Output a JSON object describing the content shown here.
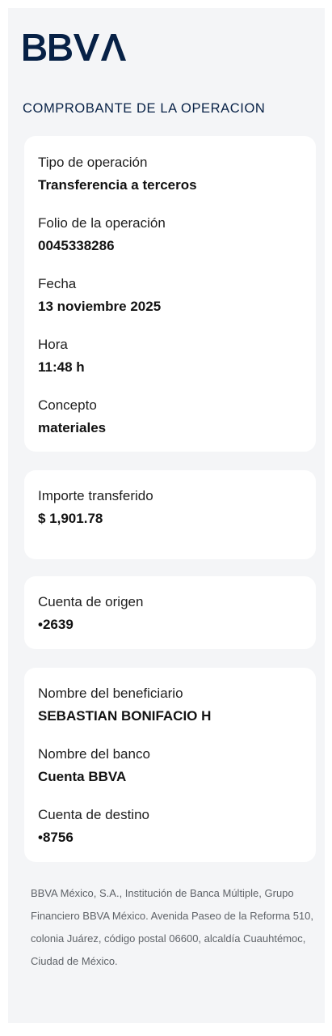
{
  "brand": {
    "name": "BBVA",
    "color": "#072146"
  },
  "receipt": {
    "title": "COMPROBANTE DE LA OPERACION",
    "operation": {
      "type_label": "Tipo de operación",
      "type_value": "Transferencia a terceros",
      "folio_label": "Folio de la operación",
      "folio_value": "0045338286",
      "date_label": "Fecha",
      "date_value": "13 noviembre 2025",
      "time_label": "Hora",
      "time_value": "11:48 h",
      "concept_label": "Concepto",
      "concept_value": "materiales"
    },
    "amount": {
      "label": "Importe transferido",
      "value": "$ 1,901.78"
    },
    "origin": {
      "label": "Cuenta de origen",
      "value": "•2639"
    },
    "beneficiary": {
      "name_label": "Nombre del beneficiario",
      "name_value": "SEBASTIAN BONIFACIO H",
      "bank_label": "Nombre del banco",
      "bank_value": "Cuenta BBVA",
      "dest_label": "Cuenta de destino",
      "dest_value": "•8756"
    }
  },
  "footer": {
    "legal_text": "BBVA México, S.A., Institución de Banca Múltiple, Grupo Financiero BBVA México. Avenida Paseo de la Reforma 510, colonia Juárez, código postal 06600, alcaldía Cuauhtémoc, Ciudad de México."
  }
}
